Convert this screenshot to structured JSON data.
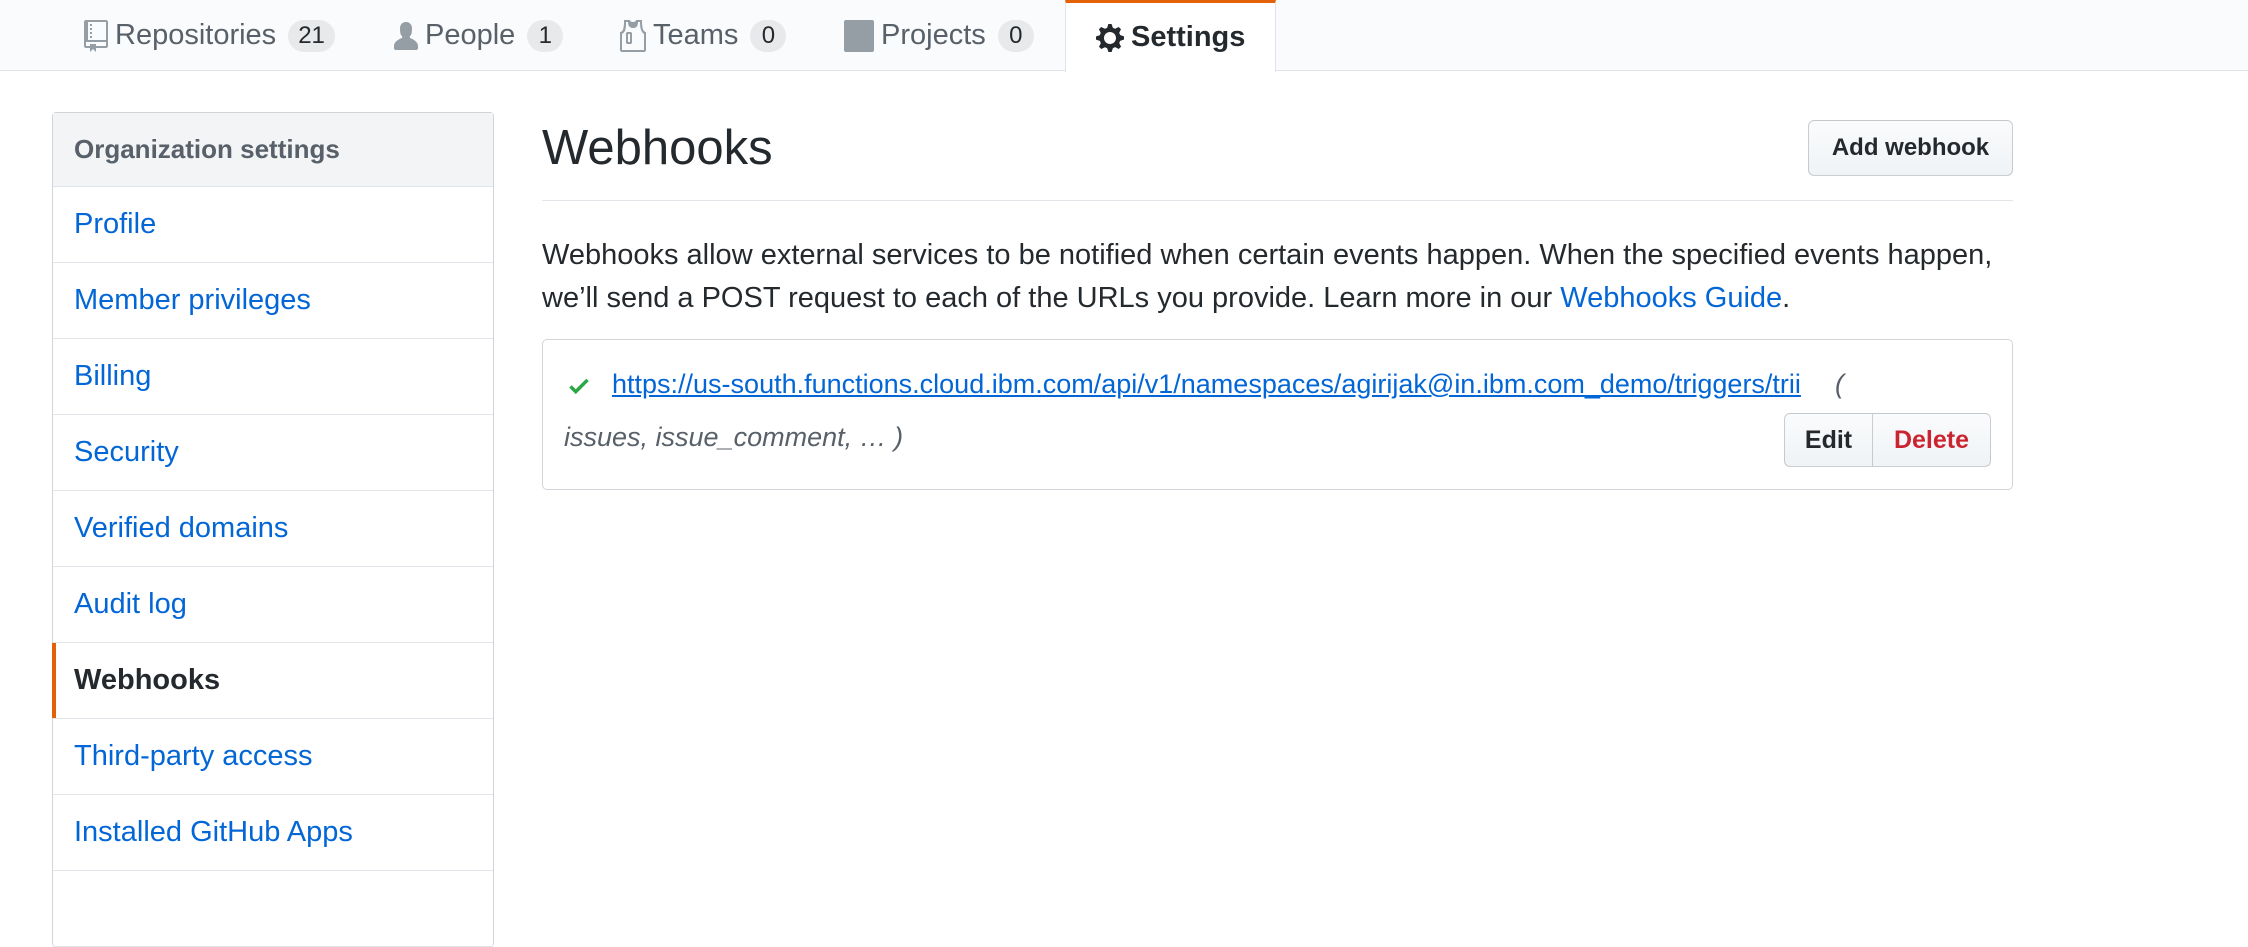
{
  "tabs": [
    {
      "label": "Repositories",
      "count": "21",
      "icon": "repo-icon"
    },
    {
      "label": "People",
      "count": "1",
      "icon": "person-icon"
    },
    {
      "label": "Teams",
      "count": "0",
      "icon": "jersey-icon"
    },
    {
      "label": "Projects",
      "count": "0",
      "icon": "project-icon"
    },
    {
      "label": "Settings",
      "icon": "gear-icon",
      "selected": true
    }
  ],
  "sidebar": {
    "header": "Organization settings",
    "items": [
      {
        "label": "Profile"
      },
      {
        "label": "Member privileges"
      },
      {
        "label": "Billing"
      },
      {
        "label": "Security"
      },
      {
        "label": "Verified domains"
      },
      {
        "label": "Audit log"
      },
      {
        "label": "Webhooks",
        "selected": true
      },
      {
        "label": "Third-party access"
      },
      {
        "label": "Installed GitHub Apps"
      }
    ]
  },
  "main": {
    "title": "Webhooks",
    "add_button": "Add webhook",
    "description_line1": "Webhooks allow external services to be notified when certain events happen. When the specified events happen,",
    "description_line2": "we’ll send a POST request to each of the URLs you provide. Learn more in our ",
    "guide_link": "Webhooks Guide",
    "description_end": ".",
    "webhook": {
      "status_icon": "check-icon",
      "url": "https://us-south.functions.cloud.ibm.com/api/v1/namespaces/agirijak@in.ibm.com_demo/triggers/trii",
      "events_open": "(",
      "events": "issues, issue_comment, … )",
      "edit_label": "Edit",
      "delete_label": "Delete"
    }
  },
  "colors": {
    "link": "#0366d6",
    "accent": "#e36209",
    "danger": "#cb2431",
    "success": "#28a745"
  }
}
